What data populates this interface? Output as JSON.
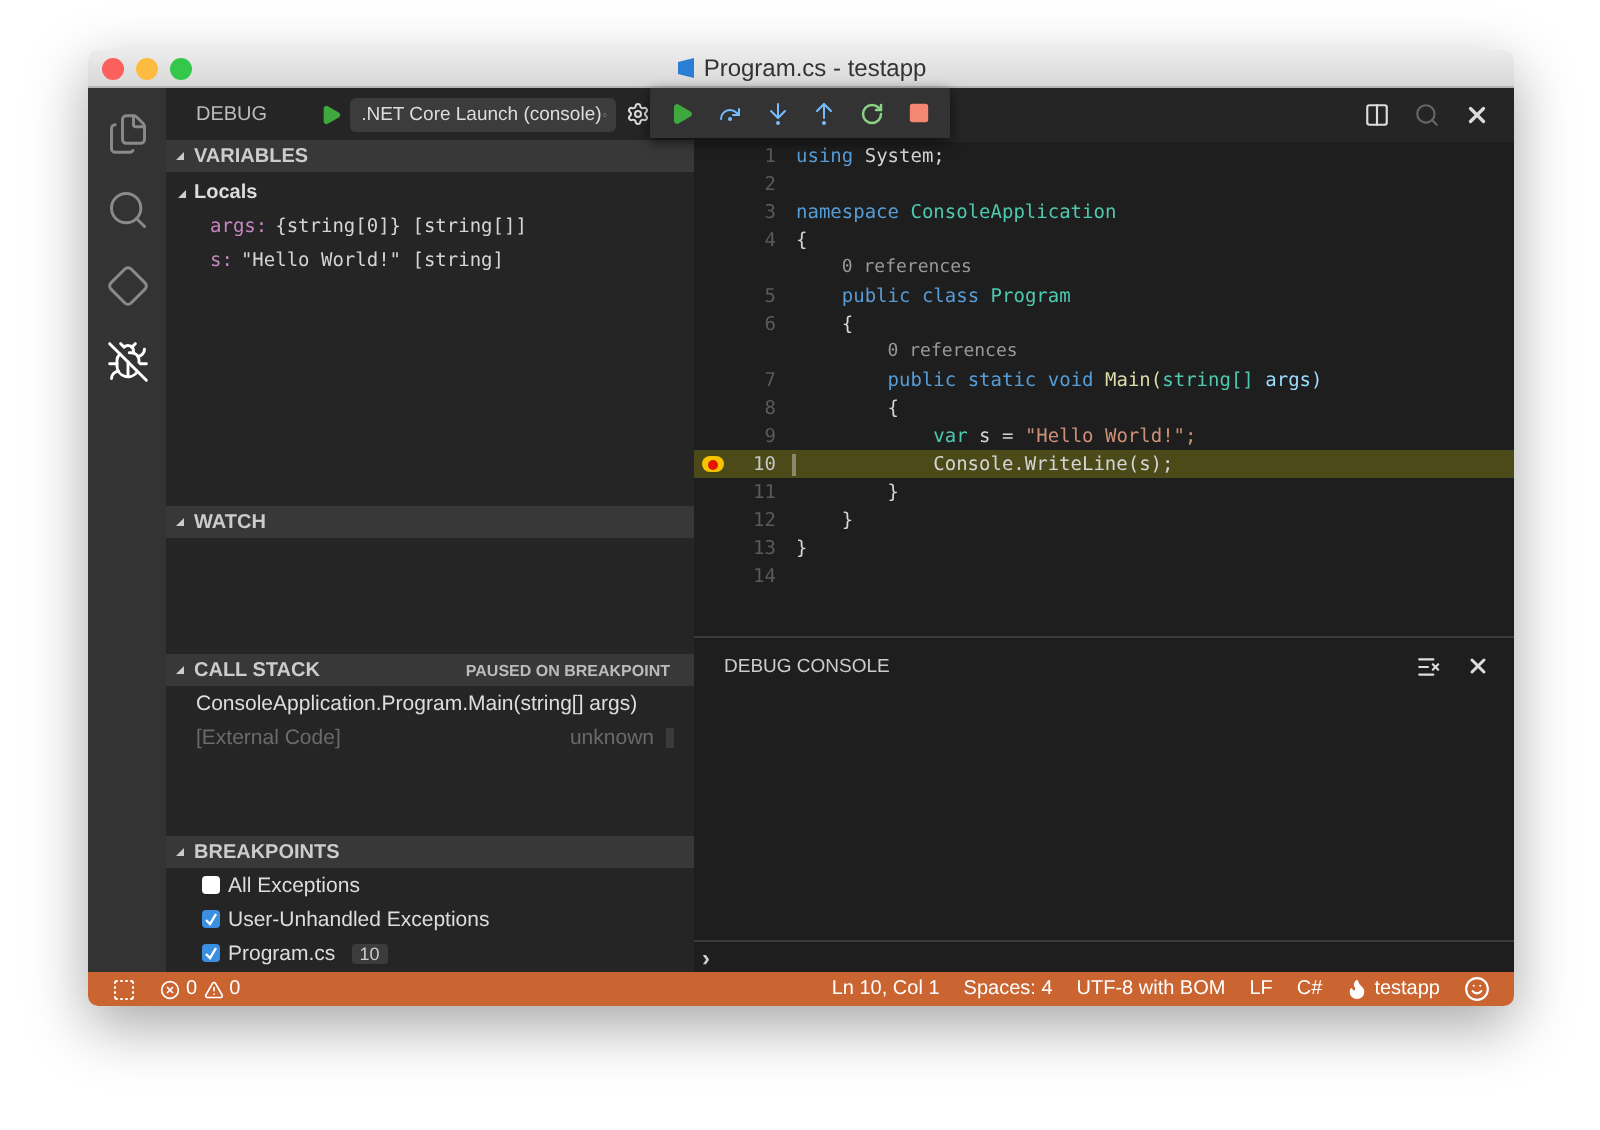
{
  "window": {
    "title": "Program.cs - testapp"
  },
  "activity_bar": [
    {
      "kind": "files",
      "selected": false
    },
    {
      "kind": "search",
      "selected": false
    },
    {
      "kind": "git",
      "selected": false
    },
    {
      "kind": "debug",
      "selected": true
    }
  ],
  "sidebar": {
    "title": "DEBUG",
    "launch_config": ".NET Core Launch (console)",
    "variables": {
      "title": "VARIABLES",
      "expanded": true,
      "scope": "Locals",
      "items": [
        {
          "name": "args:",
          "value": "{string[0]} [string[]]"
        },
        {
          "name": "s:",
          "value": "\"Hello World!\" [string]"
        }
      ]
    },
    "watch": {
      "title": "WATCH",
      "expanded": true
    },
    "call_stack": {
      "title": "CALL STACK",
      "status": "PAUSED ON BREAKPOINT",
      "frames": [
        {
          "name": "ConsoleApplication.Program.Main(string[] args)",
          "dimmed": false
        },
        {
          "name": "[External Code]",
          "source": "unknown",
          "dimmed": true
        }
      ]
    },
    "breakpoints": {
      "title": "BREAKPOINTS",
      "expanded": true,
      "items": [
        {
          "label": "All Exceptions",
          "checked": false
        },
        {
          "label": "User-Unhandled Exceptions",
          "checked": true
        },
        {
          "label": "Program.cs",
          "line": "10",
          "checked": true
        }
      ]
    }
  },
  "editor": {
    "lines": [
      {
        "kind": "code",
        "number": "1",
        "current": false,
        "breakpoint": false,
        "tokens": [
          {
            "text": "using ",
            "kind": "keyword"
          },
          {
            "text": "System;",
            "kind": "plain"
          }
        ]
      },
      {
        "kind": "code",
        "number": "2",
        "current": false,
        "breakpoint": false
      },
      {
        "kind": "code",
        "number": "3",
        "current": false,
        "breakpoint": false,
        "tokens": [
          {
            "text": "namespace ",
            "kind": "keyword"
          },
          {
            "text": "ConsoleApplication",
            "kind": "type"
          }
        ]
      },
      {
        "kind": "code",
        "number": "4",
        "current": false,
        "breakpoint": false,
        "tokens": [
          {
            "text": "{",
            "kind": "plain"
          }
        ]
      },
      {
        "kind": "codelens",
        "text": "    0 references"
      },
      {
        "kind": "code",
        "number": "5",
        "current": false,
        "breakpoint": false,
        "tokens": [
          {
            "text": "    public ",
            "kind": "keyword"
          },
          {
            "text": "class ",
            "kind": "keyword"
          },
          {
            "text": "Program",
            "kind": "type"
          }
        ]
      },
      {
        "kind": "code",
        "number": "6",
        "current": false,
        "breakpoint": false,
        "tokens": [
          {
            "text": "    {",
            "kind": "plain"
          }
        ]
      },
      {
        "kind": "codelens",
        "text": "        0 references"
      },
      {
        "kind": "code",
        "number": "7",
        "current": false,
        "breakpoint": false,
        "tokens": [
          {
            "text": "        public ",
            "kind": "keyword"
          },
          {
            "text": "static ",
            "kind": "keyword"
          },
          {
            "text": "void ",
            "kind": "keyword"
          },
          {
            "text": "Main(",
            "kind": "function"
          },
          {
            "text": "string[] ",
            "kind": "type"
          },
          {
            "text": "args)",
            "kind": "param"
          }
        ]
      },
      {
        "kind": "code",
        "number": "8",
        "current": false,
        "breakpoint": false,
        "tokens": [
          {
            "text": "        {",
            "kind": "plain"
          }
        ]
      },
      {
        "kind": "code",
        "number": "9",
        "current": false,
        "breakpoint": false,
        "tokens": [
          {
            "text": "            var ",
            "kind": "type"
          },
          {
            "text": "s = ",
            "kind": "plain"
          },
          {
            "text": "\"Hello World!\";",
            "kind": "string"
          }
        ]
      },
      {
        "kind": "code",
        "number": "10",
        "current": true,
        "breakpoint": true,
        "tokens": [
          {
            "text": "            Console.WriteLine(s);",
            "kind": "plain"
          }
        ]
      },
      {
        "kind": "code",
        "number": "11",
        "current": false,
        "breakpoint": false,
        "tokens": [
          {
            "text": "        }",
            "kind": "plain"
          }
        ]
      },
      {
        "kind": "code",
        "number": "12",
        "current": false,
        "breakpoint": false,
        "tokens": [
          {
            "text": "    }",
            "kind": "plain"
          }
        ]
      },
      {
        "kind": "code",
        "number": "13",
        "current": false,
        "breakpoint": false,
        "tokens": [
          {
            "text": "}",
            "kind": "plain"
          }
        ]
      },
      {
        "kind": "code",
        "number": "14",
        "current": false,
        "breakpoint": false
      }
    ]
  },
  "panel": {
    "title": "DEBUG CONSOLE",
    "prompt": "›"
  },
  "status_bar": {
    "errors": "0",
    "warnings": "0",
    "right": [
      {
        "kind": "text",
        "text": "Ln 10, Col 1"
      },
      {
        "kind": "text",
        "text": "Spaces: 4"
      },
      {
        "kind": "text",
        "text": "UTF-8 with BOM"
      },
      {
        "kind": "text",
        "text": "LF"
      },
      {
        "kind": "text",
        "text": "C#"
      },
      {
        "kind": "project",
        "text": "testapp"
      }
    ]
  }
}
